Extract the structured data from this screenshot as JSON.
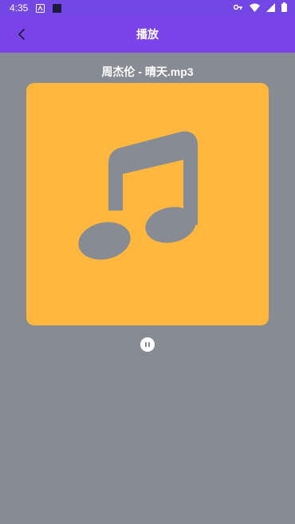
{
  "status": {
    "time": "4:35"
  },
  "app_bar": {
    "title": "播放"
  },
  "player": {
    "song_title": "周杰伦 - 晴天.mp3"
  }
}
